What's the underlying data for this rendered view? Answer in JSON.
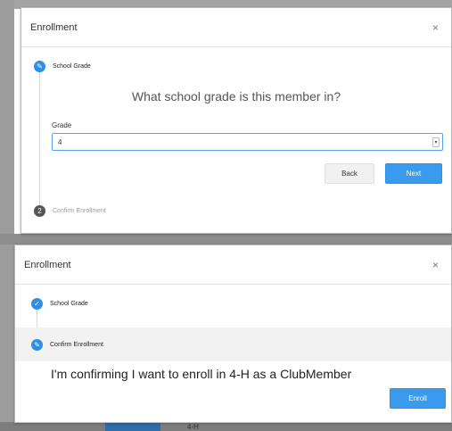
{
  "dialog1": {
    "title": "Enrollment",
    "close": "×",
    "step1_label": "School Grade",
    "step2_label": "Confirm Enrollment",
    "question": "What school grade is this member in?",
    "grade_label": "Grade",
    "grade_value": "4",
    "back_label": "Back",
    "next_label": "Next"
  },
  "dialog2": {
    "title": "Enrollment",
    "close": "×",
    "step1_label": "School Grade",
    "step2_label": "Confirm Enrollment",
    "confirm_text": "I'm confirming I want to enroll in 4-H as a ClubMember",
    "enroll_label": "Enroll"
  },
  "background": {
    "partial_text": "4-H"
  },
  "colors": {
    "accent": "#3a9bee",
    "step_active": "#2f8fe0",
    "step_inactive": "#555555"
  }
}
